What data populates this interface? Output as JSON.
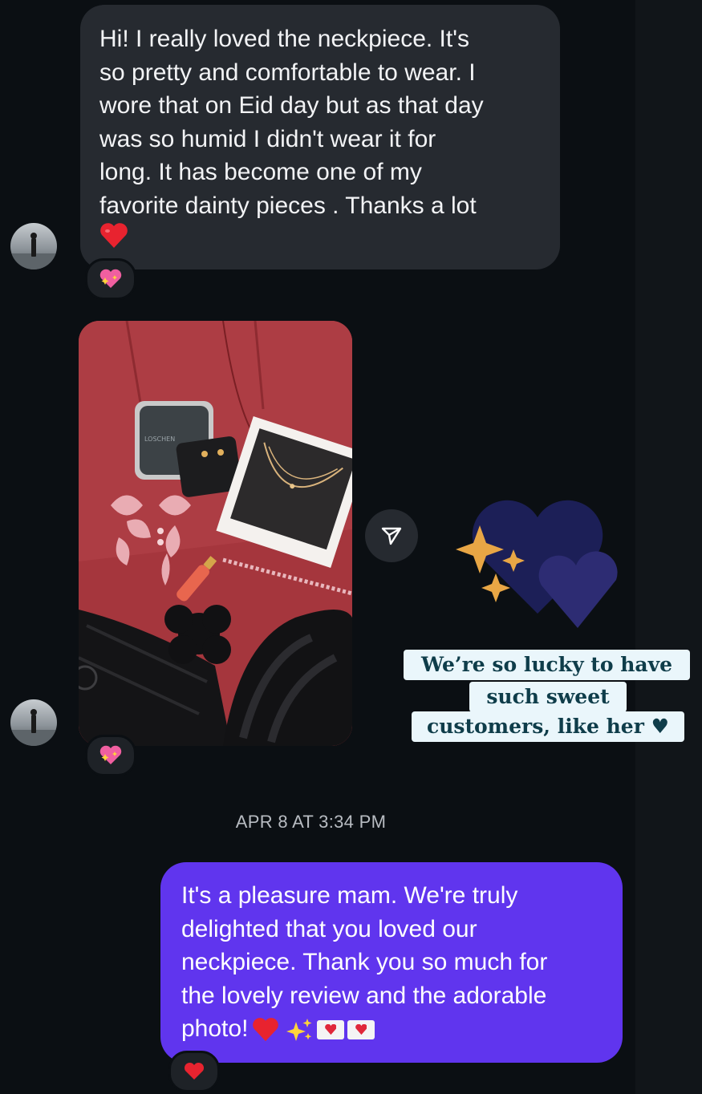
{
  "thread": {
    "incoming_message": {
      "text": "Hi! I really loved the neckpiece. It's\nso pretty and comfortable to wear. I\nwore that on Eid day but as that day\nwas so humid I didn't wear it for\nlong. It has become one of my\nfavorite dainty pieces . Thanks a lot",
      "emoji": "red-heart",
      "reaction": "heart-with-sparkles"
    },
    "incoming_photo": {
      "box_logo_text": "LOSCHEN",
      "reaction": "heart-with-sparkles"
    },
    "timestamp": "APR 8 AT 3:34 PM",
    "outgoing_message": {
      "text": "It's a pleasure mam. We're truly\ndelighted that you loved our\nneckpiece. Thank you so much for\nthe lovely review and the adorable\nphoto!",
      "emojis": [
        "red-heart",
        "sparkles",
        "love-letter",
        "love-letter"
      ],
      "reaction": "red-heart"
    }
  },
  "sticker": {
    "line1": "We’re so lucky to have",
    "line2": "such sweet",
    "line3": "customers, like her ♥"
  },
  "colors": {
    "background": "#0b0f13",
    "incoming_bubble": "#262a30",
    "outgoing_bubble": "#6035ee",
    "sticker_bg": "#eaf6fb",
    "sticker_text": "#0f3d4a"
  }
}
